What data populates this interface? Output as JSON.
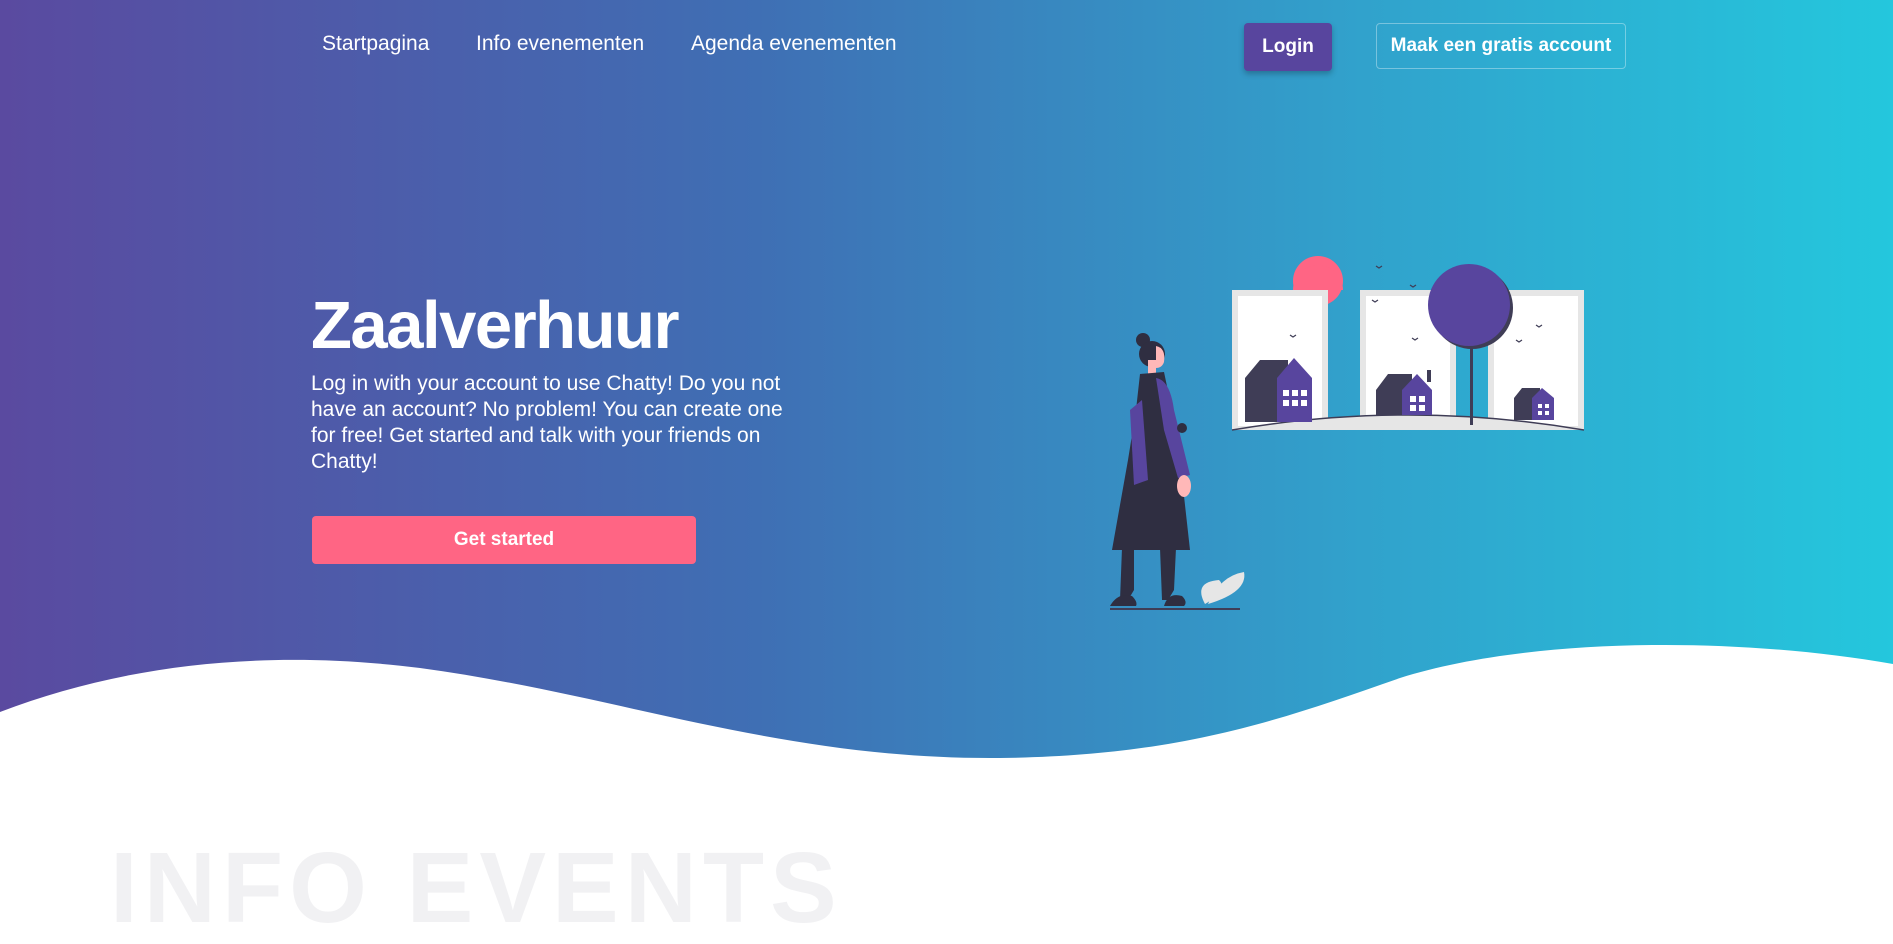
{
  "nav": {
    "links": [
      "Startpagina",
      "Info evenementen",
      "Agenda evenementen"
    ],
    "login_label": "Login",
    "signup_label": "Maak een gratis account"
  },
  "hero": {
    "title": "Zaalverhuur",
    "description": "Log in with your account to use Chatty! Do you not have an account? No problem! You can create one for free! Get started and talk with your friends on Chatty!",
    "cta_label": "Get started"
  },
  "next_section": {
    "heading": "INFO EVENTS"
  },
  "colors": {
    "gradient_start": "#5a4aa0",
    "gradient_end": "#24c7dd",
    "login_button": "#58459e",
    "cta_button": "#ff6584",
    "illustration_purple": "#58459e",
    "illustration_pink": "#ff6584",
    "illustration_dark": "#2f2e41"
  },
  "icons": {
    "illustration": "woman-looking-at-houses-illustration"
  }
}
